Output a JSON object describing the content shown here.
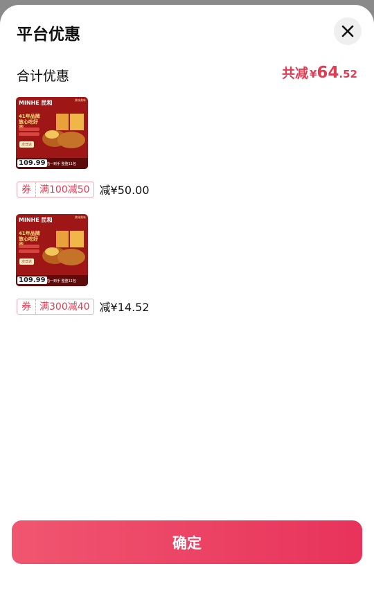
{
  "sheet": {
    "title": "平台优惠"
  },
  "summary": {
    "label": "合计优惠",
    "total_prefix": "共减",
    "currency": "¥",
    "total_int": "64",
    "total_dec": ".52"
  },
  "items": [
    {
      "product": {
        "brand": "MINHE 民和",
        "brand_tag": "美味美味",
        "headline": "41年品牌 放心吃好肉",
        "next_day": "次日达",
        "price": "109.99",
        "slogan": "拍一到手 整整11包"
      },
      "coupon": {
        "tag": "券",
        "condition": "满100减50"
      },
      "discount": "减¥50.00"
    },
    {
      "product": {
        "brand": "MINHE 民和",
        "brand_tag": "美味美味",
        "headline": "41年品牌 放心吃好肉",
        "next_day": "次日达",
        "price": "109.99",
        "slogan": "拍一到手 整整11包"
      },
      "coupon": {
        "tag": "券",
        "condition": "满300减40"
      },
      "discount": "减¥14.52"
    }
  ],
  "confirm_label": "确定",
  "colors": {
    "accent": "#e03d55",
    "button_start": "#f05670",
    "button_end": "#e8335a"
  },
  "icons": {
    "close": "close-icon"
  }
}
